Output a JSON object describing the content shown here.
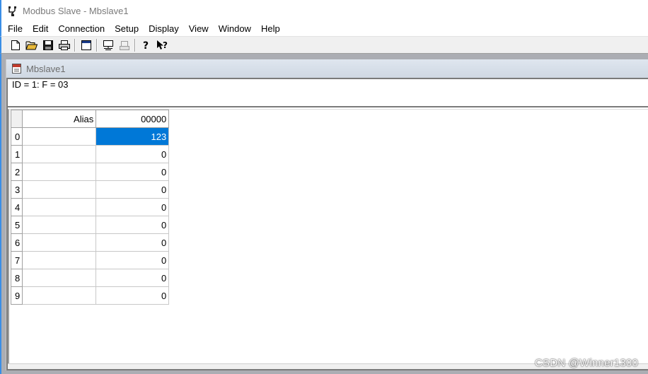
{
  "window": {
    "title": "Modbus Slave - Mbslave1",
    "icon": "modbus-app-icon"
  },
  "menu": [
    "File",
    "Edit",
    "Connection",
    "Setup",
    "Display",
    "View",
    "Window",
    "Help"
  ],
  "toolbar": {
    "buttons": [
      "new-icon",
      "open-icon",
      "save-icon",
      "print-icon",
      "window-icon",
      "connect-icon",
      "disconnect-icon",
      "help-icon",
      "context-help-icon"
    ]
  },
  "child": {
    "title": "Mbslave1",
    "header": "ID = 1: F = 03",
    "grid": {
      "columns": [
        "Alias",
        "00000"
      ],
      "rows": [
        {
          "index": "0",
          "alias": "",
          "value": "123",
          "selected": true
        },
        {
          "index": "1",
          "alias": "",
          "value": "0"
        },
        {
          "index": "2",
          "alias": "",
          "value": "0"
        },
        {
          "index": "3",
          "alias": "",
          "value": "0"
        },
        {
          "index": "4",
          "alias": "",
          "value": "0"
        },
        {
          "index": "5",
          "alias": "",
          "value": "0"
        },
        {
          "index": "6",
          "alias": "",
          "value": "0"
        },
        {
          "index": "7",
          "alias": "",
          "value": "0"
        },
        {
          "index": "8",
          "alias": "",
          "value": "0"
        },
        {
          "index": "9",
          "alias": "",
          "value": "0"
        }
      ]
    }
  },
  "watermark": "CSDN @Winner1300",
  "colors": {
    "selection": "#0078d7",
    "window_accent": "#3a8ee6"
  }
}
